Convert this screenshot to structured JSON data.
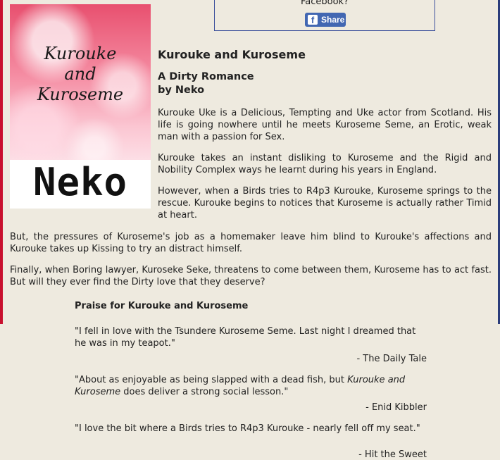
{
  "share": {
    "prompt": "Facebook?",
    "button_label": "Share",
    "icon_glyph": "f"
  },
  "cover": {
    "title": "Kurouke and Kuroseme",
    "author": "Neko"
  },
  "book": {
    "title": "Kurouke and Kuroseme",
    "subtitle": "A Dirty Romance",
    "byline": "by Neko"
  },
  "blurb": [
    "Kurouke Uke is a Delicious, Tempting and Uke actor from Scotland. His life is going nowhere until he meets Kuroseme Seme, an Erotic, weak man with a passion for Sex.",
    "Kurouke takes an instant disliking to Kuroseme and the Rigid and Nobility Complex ways he learnt during his years in England.",
    "However, when a Birds tries to R4p3 Kurouke, Kuroseme springs to the rescue. Kurouke begins to notices that Kuroseme is actually rather Timid at heart.",
    "But, the pressures of Kuroseme's job as a homemaker leave him blind to Kurouke's affections and Kurouke takes up Kissing to try an distract himself.",
    "Finally, when Boring lawyer, Kuroseke Seke, threatens to come between them, Kuroseme has to act fast. But will they ever find the Dirty love that they deserve?"
  ],
  "praise": {
    "heading": "Praise for Kurouke and Kuroseme",
    "quotes": [
      {
        "text": "\"I fell in love with the Tsundere Kuroseme Seme. Last night I dreamed that he was in my teapot.\"",
        "source": "- The Daily Tale"
      },
      {
        "text_before": "\"About as enjoyable as being slapped with a dead fish, but ",
        "text_italic": "Kurouke and Kuroseme",
        "text_after": " does deliver a strong social lesson.\"",
        "source": "- Enid Kibbler"
      },
      {
        "text": "\"I love the bit where a Birds tries to R4p3 Kurouke - nearly fell off my seat.\"",
        "source": "- Hit the Sweet"
      }
    ]
  },
  "colors": {
    "background": "#eeeadf",
    "facebook_blue": "#4267b2",
    "left_stripe": "#c8102e",
    "right_stripe": "#2a3c7a"
  }
}
